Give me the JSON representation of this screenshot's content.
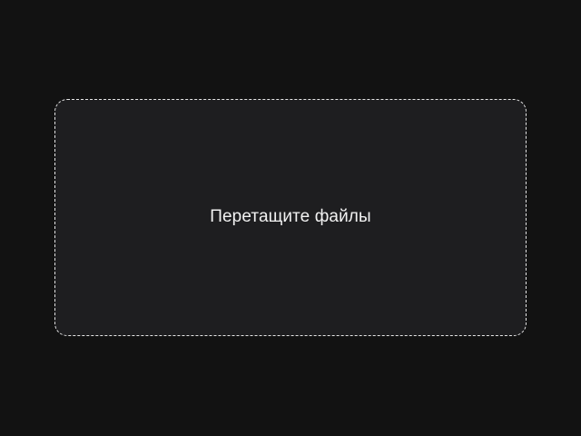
{
  "dropzone": {
    "label": "Перетащите файлы"
  },
  "colors": {
    "background": "#121212",
    "dropzone_fill": "#1e1e20",
    "dropzone_border": "#e6e6e6",
    "text": "#f2f2f2"
  }
}
